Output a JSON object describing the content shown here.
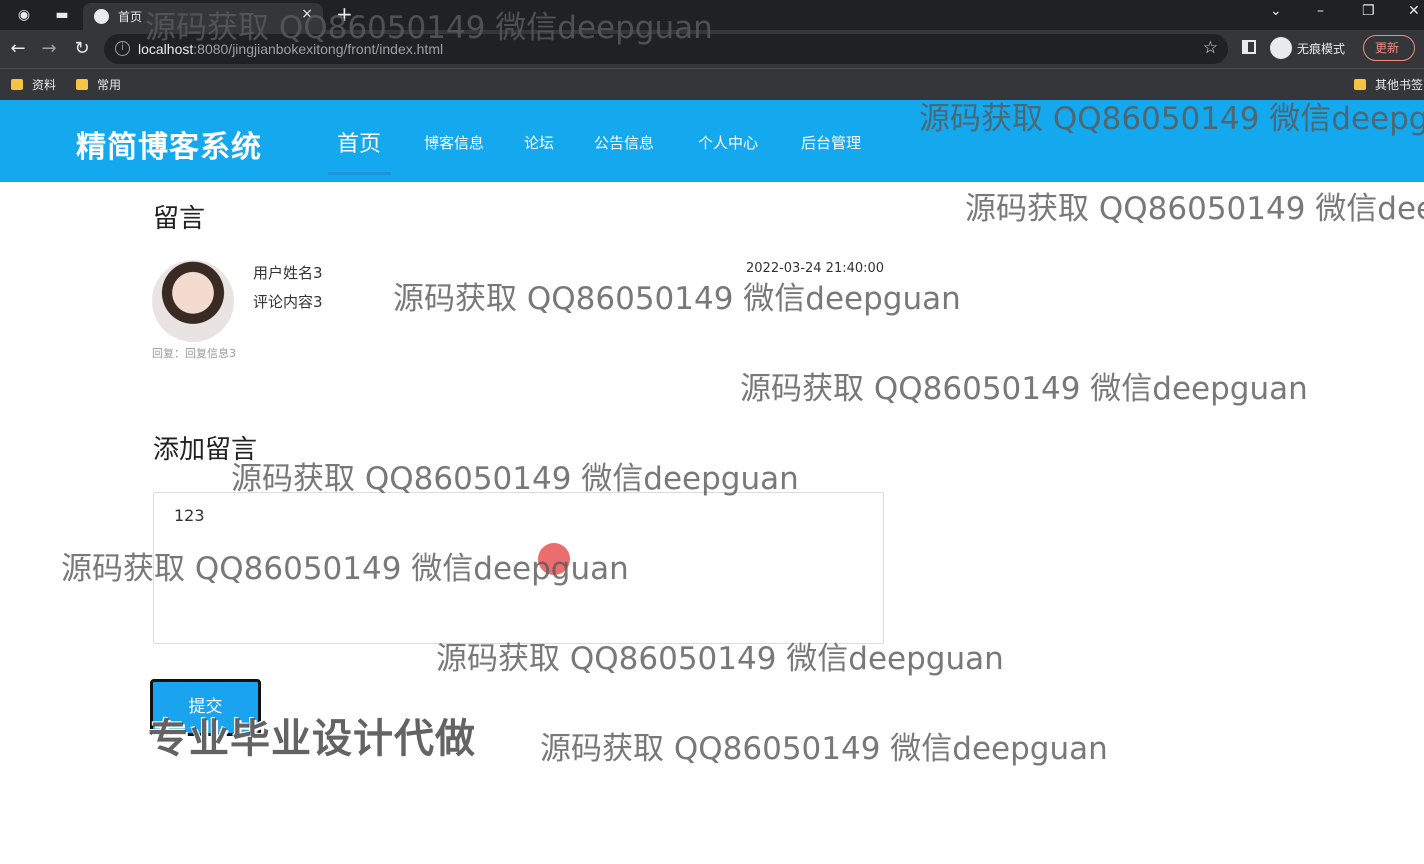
{
  "browser": {
    "tab_title": "首页",
    "tab_close": "×",
    "new_tab": "+",
    "url_host": "localhost",
    "url_rest": ":8080/jingjianbokexitong/front/index.html",
    "incognito_label": "无痕模式",
    "update_label": "更新",
    "bookmarks": [
      "资料",
      "常用",
      "其他书签"
    ]
  },
  "site": {
    "brand": "精简博客系统",
    "nav": [
      "首页",
      "博客信息",
      "论坛",
      "公告信息",
      "个人中心",
      "后台管理"
    ]
  },
  "comments": {
    "section_title": "留言",
    "items": [
      {
        "user": "用户姓名3",
        "content": "评论内容3",
        "time": "2022-03-24 21:40:00",
        "reply": "回复：回复信息3"
      }
    ]
  },
  "add_comment": {
    "section_title": "添加留言",
    "input_value": "123",
    "submit_label": "提交"
  },
  "overlay": {
    "promo": "专业毕业设计代做",
    "watermark": "源码获取 QQ86050149 微信deepguan"
  },
  "colors": {
    "header_bg": "#14a8ee",
    "button_bg": "#1aa3ef"
  }
}
